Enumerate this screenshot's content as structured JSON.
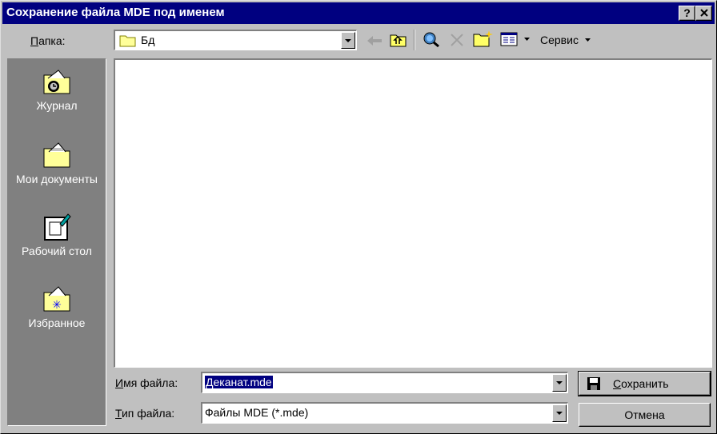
{
  "window": {
    "title": "Сохранение файла MDE под именем",
    "help_button": "?",
    "close_button": "×"
  },
  "toolbar": {
    "folder_label": "Папка:",
    "folder_label_accel": "П",
    "folder_label_rest": "апка:",
    "current_folder": "Бд",
    "service_menu": "Сервис",
    "icons": [
      "back-arrow-icon",
      "up-folder-icon",
      "search-web-icon",
      "delete-icon",
      "new-folder-icon",
      "views-icon"
    ]
  },
  "places": [
    {
      "label": "Журнал",
      "icon": "history-folder-icon"
    },
    {
      "label": "Мои документы",
      "icon": "my-documents-folder-icon"
    },
    {
      "label": "Рабочий стол",
      "icon": "desktop-icon"
    },
    {
      "label": "Избранное",
      "icon": "favorites-folder-icon"
    }
  ],
  "form": {
    "filename_label_accel": "И",
    "filename_label_rest": "мя файла:",
    "filename_value": "Деканат.mde",
    "filetype_label_accel": "Т",
    "filetype_label_rest": "ип файла:",
    "filetype_value": "Файлы MDE (*.mde)"
  },
  "buttons": {
    "save_accel": "С",
    "save_rest": "охранить",
    "cancel": "Отмена"
  }
}
